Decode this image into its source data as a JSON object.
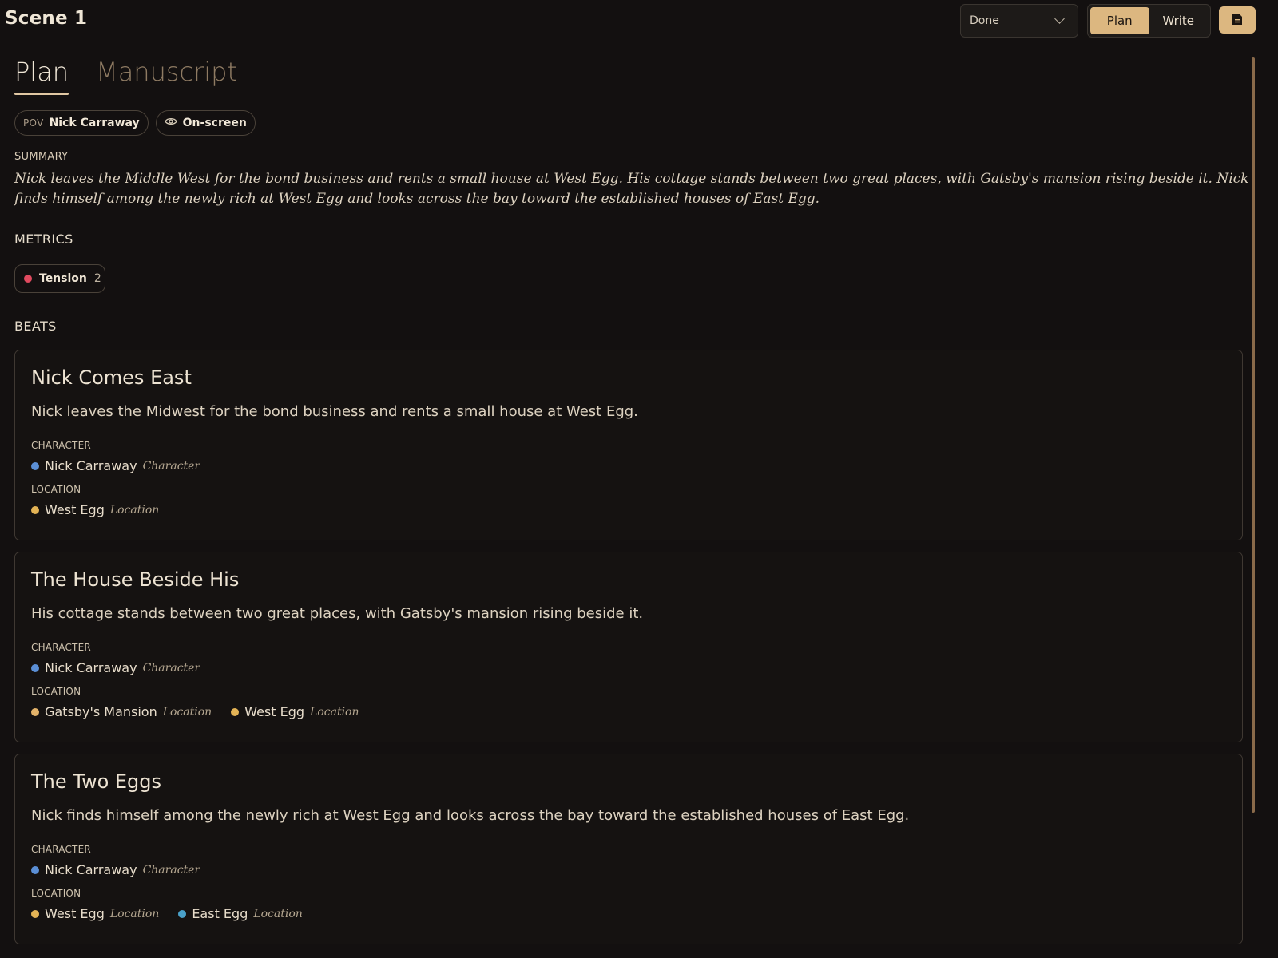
{
  "header": {
    "scene_title": "Scene 1",
    "status": "Done",
    "mode_buttons": [
      "Plan",
      "Write"
    ],
    "active_mode": "Plan"
  },
  "tabs": [
    {
      "label": "Plan",
      "active": true
    },
    {
      "label": "Manuscript",
      "active": false
    }
  ],
  "chips": {
    "pov_label": "POV",
    "pov_value": "Nick Carraway",
    "visibility": "On-screen"
  },
  "summary": {
    "label": "SUMMARY",
    "text": "Nick leaves the Middle West for the bond business and rents a small house at West Egg. His cottage stands between two great places, with Gatsby's mansion rising beside it. Nick finds himself among the newly rich at West Egg and looks across the bay toward the established houses of East Egg."
  },
  "metrics": {
    "label": "METRICS",
    "items": [
      {
        "name": "Tension",
        "value": "2",
        "color": "#e04a5f"
      }
    ]
  },
  "beats": {
    "label": "BEATS",
    "character_label": "CHARACTER",
    "location_label": "LOCATION",
    "items": [
      {
        "title": "Nick Comes East",
        "description": "Nick leaves the Midwest for the bond business and rents a small house at West Egg.",
        "characters": [
          {
            "name": "Nick Carraway",
            "type": "Character",
            "color": "#5b8fd6"
          }
        ],
        "locations": [
          {
            "name": "West Egg",
            "type": "Location",
            "color": "#e3b355"
          }
        ]
      },
      {
        "title": "The House Beside His",
        "description": "His cottage stands between two great places, with Gatsby's mansion rising beside it.",
        "characters": [
          {
            "name": "Nick Carraway",
            "type": "Character",
            "color": "#5b8fd6"
          }
        ],
        "locations": [
          {
            "name": "Gatsby's Mansion",
            "type": "Location",
            "color": "#e3b36a"
          },
          {
            "name": "West Egg",
            "type": "Location",
            "color": "#e3b355"
          }
        ]
      },
      {
        "title": "The Two Eggs",
        "description": "Nick finds himself among the newly rich at West Egg and looks across the bay toward the established houses of East Egg.",
        "characters": [
          {
            "name": "Nick Carraway",
            "type": "Character",
            "color": "#5b8fd6"
          }
        ],
        "locations": [
          {
            "name": "West Egg",
            "type": "Location",
            "color": "#e3b355"
          },
          {
            "name": "East Egg",
            "type": "Location",
            "color": "#4aa1c9"
          }
        ]
      }
    ]
  },
  "colors": {
    "background": "#131010",
    "accent": "#dcb780",
    "card_border": "#3f3832"
  },
  "icons": {
    "status_dropdown": "chevron-down-icon",
    "visibility": "eye-icon",
    "save": "document-icon"
  }
}
